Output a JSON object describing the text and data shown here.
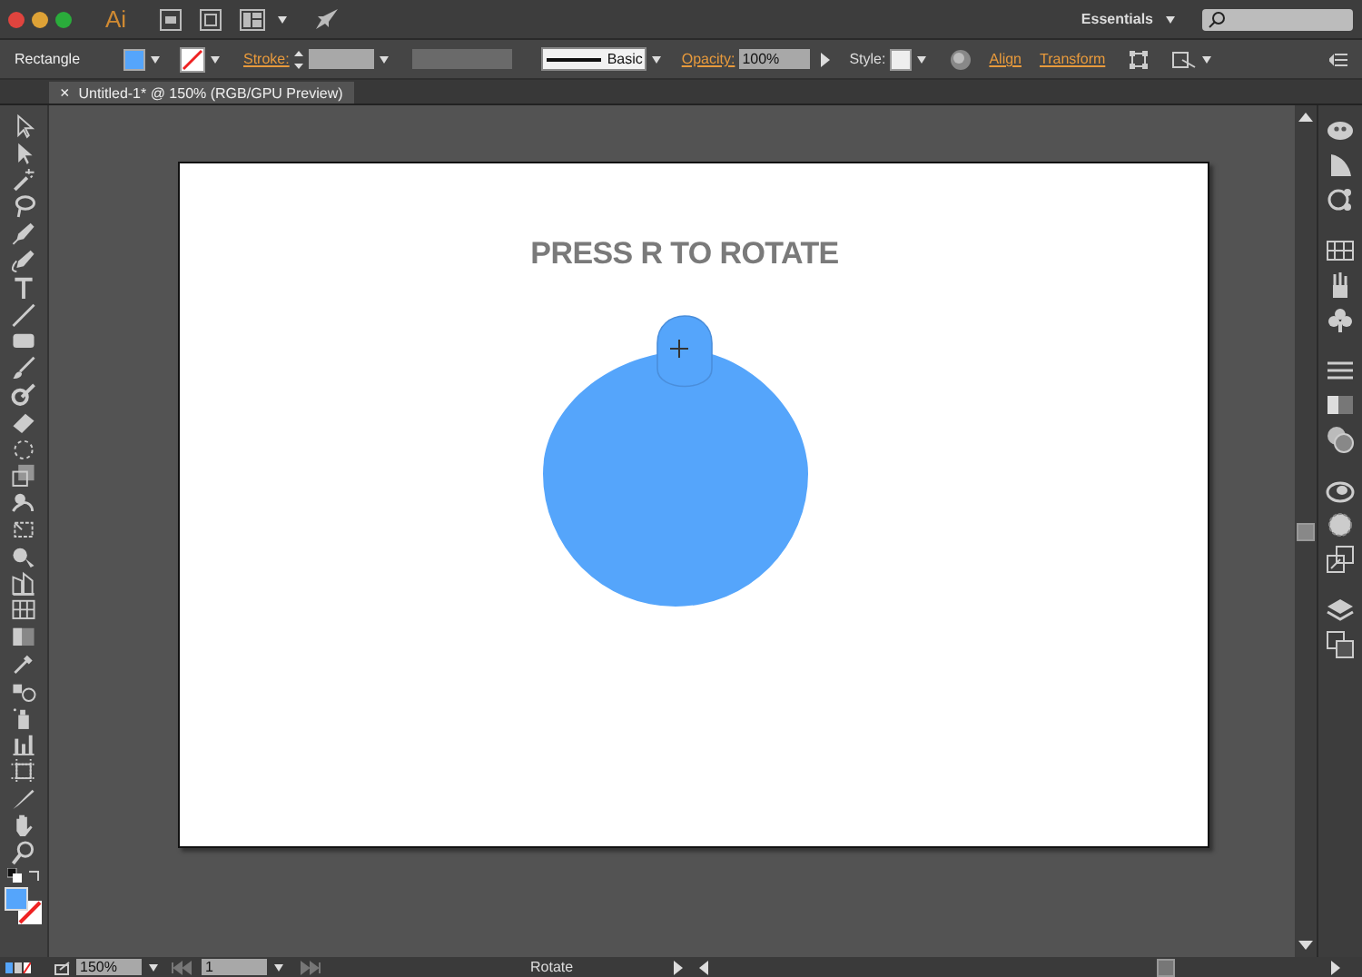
{
  "app_bar": {
    "logo": "Ai",
    "workspace": "Essentials"
  },
  "control_bar": {
    "selection": "Rectangle",
    "stroke_label": "Stroke:",
    "brush": "Basic",
    "opacity_label": "Opacity:",
    "opacity": "100%",
    "style_label": "Style:",
    "links": [
      "Align",
      "Transform"
    ]
  },
  "document_tabs": [
    {
      "title": "Untitled-1* @ 150% (RGB/GPU Preview)",
      "close": "×",
      "selected": true
    }
  ],
  "artboard": {
    "heading": "PRESS R TO ROTATE"
  },
  "status_bar": {
    "zoom": "150%",
    "page": "1",
    "status": "Rotate"
  }
}
